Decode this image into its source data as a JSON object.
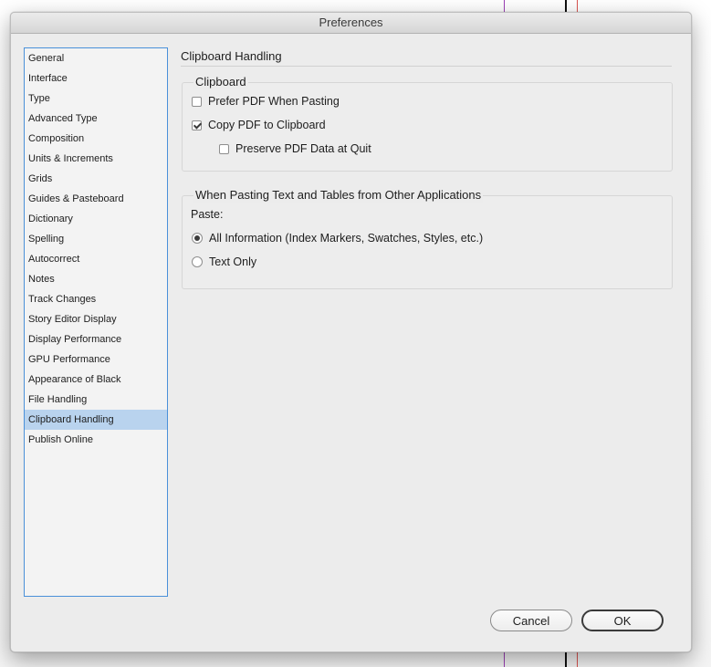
{
  "window": {
    "title": "Preferences"
  },
  "sidebar": {
    "items": [
      {
        "label": "General"
      },
      {
        "label": "Interface"
      },
      {
        "label": "Type"
      },
      {
        "label": "Advanced Type"
      },
      {
        "label": "Composition"
      },
      {
        "label": "Units & Increments"
      },
      {
        "label": "Grids"
      },
      {
        "label": "Guides & Pasteboard"
      },
      {
        "label": "Dictionary"
      },
      {
        "label": "Spelling"
      },
      {
        "label": "Autocorrect"
      },
      {
        "label": "Notes"
      },
      {
        "label": "Track Changes"
      },
      {
        "label": "Story Editor Display"
      },
      {
        "label": "Display Performance"
      },
      {
        "label": "GPU Performance"
      },
      {
        "label": "Appearance of Black"
      },
      {
        "label": "File Handling"
      },
      {
        "label": "Clipboard Handling"
      },
      {
        "label": "Publish Online"
      }
    ],
    "selected": "Clipboard Handling"
  },
  "main": {
    "section_title": "Clipboard Handling",
    "clipboard_group": {
      "legend": "Clipboard",
      "prefer_pdf": {
        "label": "Prefer PDF When Pasting",
        "checked": false
      },
      "copy_pdf": {
        "label": "Copy PDF to Clipboard",
        "checked": true
      },
      "preserve_pdf": {
        "label": "Preserve PDF Data at Quit",
        "checked": false
      }
    },
    "pasting_group": {
      "legend": "When Pasting Text and Tables from Other Applications",
      "paste_label": "Paste:",
      "all_information": {
        "label": "All Information (Index Markers, Swatches, Styles, etc.)",
        "selected": true
      },
      "text_only": {
        "label": "Text Only",
        "selected": false
      }
    }
  },
  "buttons": {
    "cancel": "Cancel",
    "ok": "OK"
  },
  "colors": {
    "selection": "#b9d3ee",
    "sidebar_border": "#4a90d9",
    "guide_purple": "#9b3fb5",
    "guide_red": "#d9534f"
  }
}
